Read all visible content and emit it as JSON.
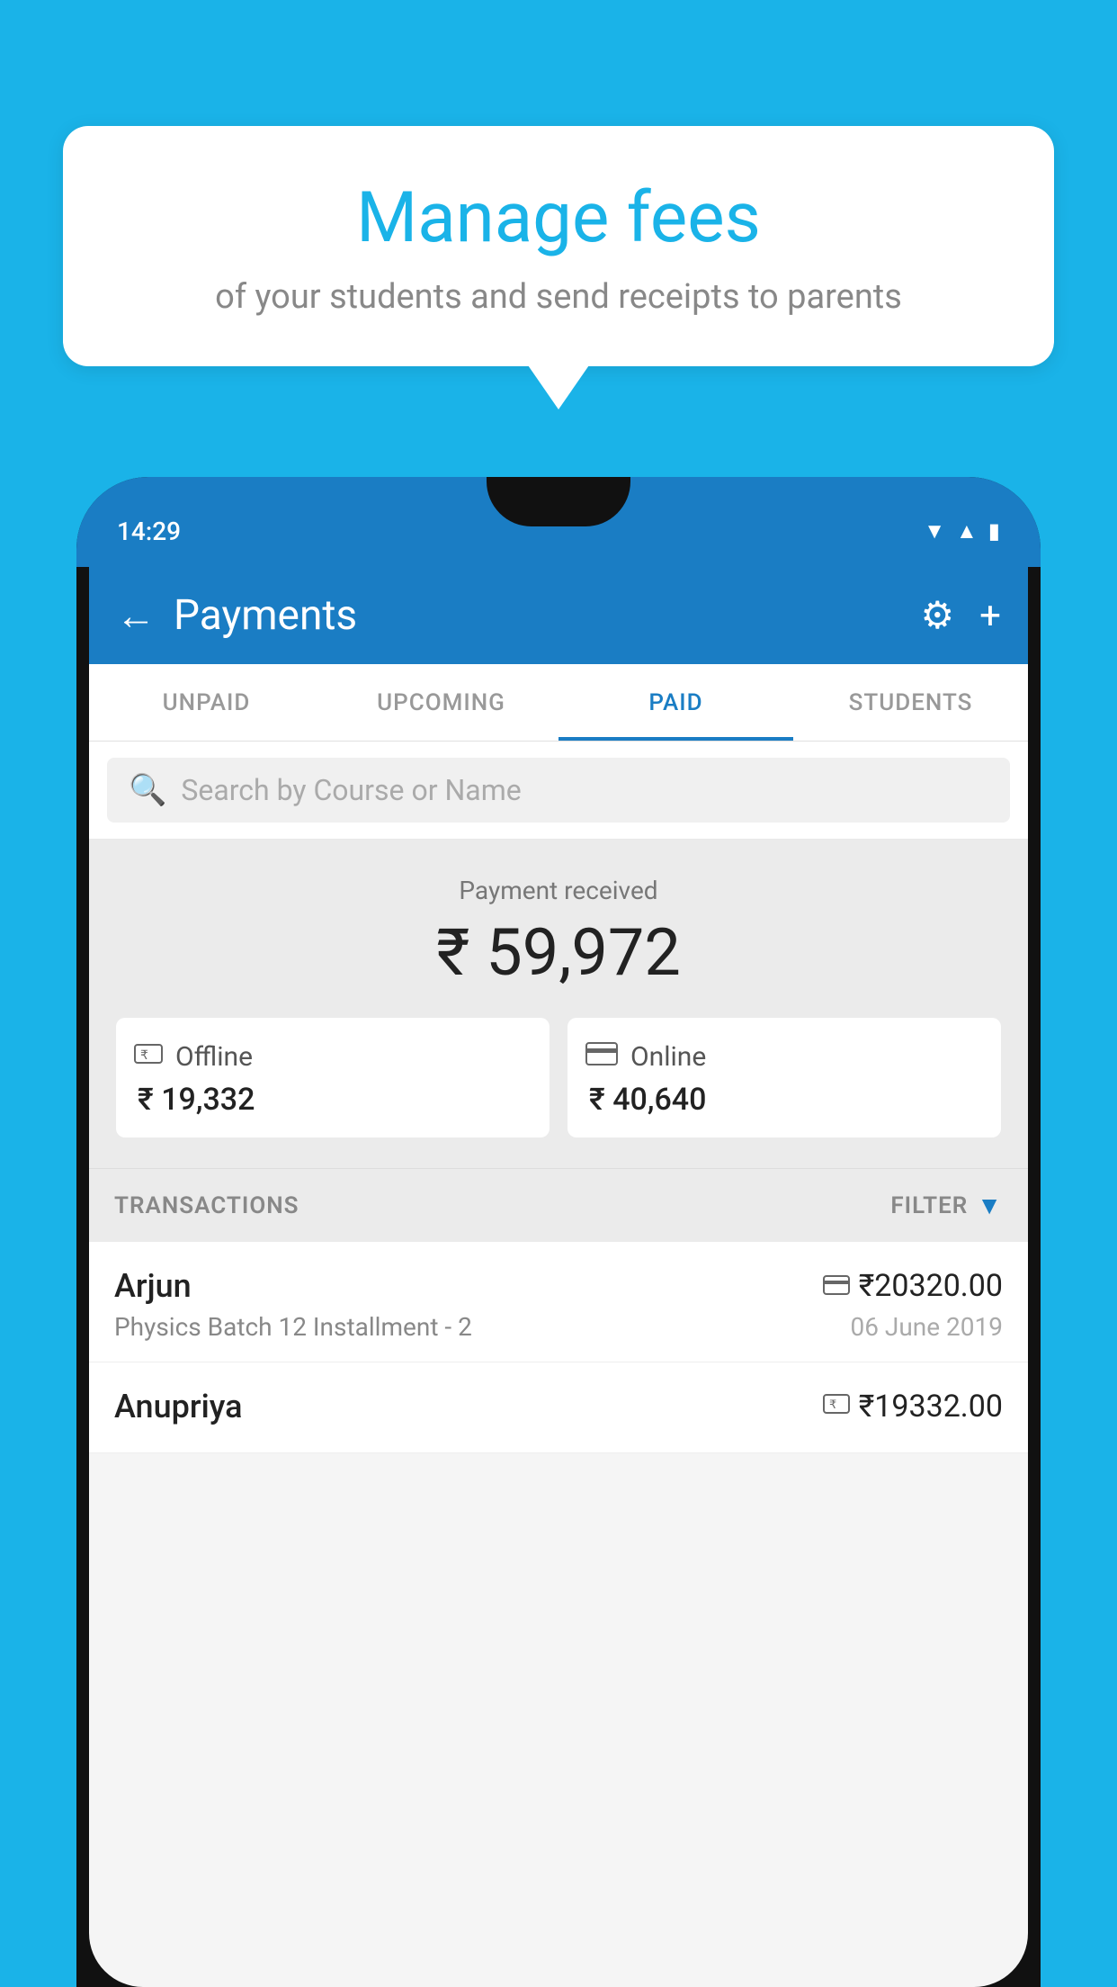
{
  "background_color": "#1ab3e8",
  "tooltip": {
    "title": "Manage fees",
    "subtitle": "of your students and send receipts to parents"
  },
  "status_bar": {
    "time": "14:29",
    "wifi_icon": "▲",
    "signal_icon": "▲",
    "battery_icon": "▮"
  },
  "app_bar": {
    "back_icon": "←",
    "title": "Payments",
    "settings_icon": "⚙",
    "add_icon": "+"
  },
  "tabs": [
    {
      "label": "UNPAID",
      "active": false
    },
    {
      "label": "UPCOMING",
      "active": false
    },
    {
      "label": "PAID",
      "active": true
    },
    {
      "label": "STUDENTS",
      "active": false
    }
  ],
  "search": {
    "placeholder": "Search by Course or Name",
    "icon": "🔍"
  },
  "payment_summary": {
    "label": "Payment received",
    "amount": "₹ 59,972",
    "offline": {
      "type": "Offline",
      "amount": "₹ 19,332"
    },
    "online": {
      "type": "Online",
      "amount": "₹ 40,640"
    }
  },
  "transactions_section": {
    "label": "TRANSACTIONS",
    "filter_label": "FILTER"
  },
  "transactions": [
    {
      "name": "Arjun",
      "amount": "₹20320.00",
      "course": "Physics Batch 12 Installment - 2",
      "date": "06 June 2019",
      "icon": "card"
    },
    {
      "name": "Anupriya",
      "amount": "₹19332.00",
      "course": "",
      "date": "",
      "icon": "cash"
    }
  ]
}
